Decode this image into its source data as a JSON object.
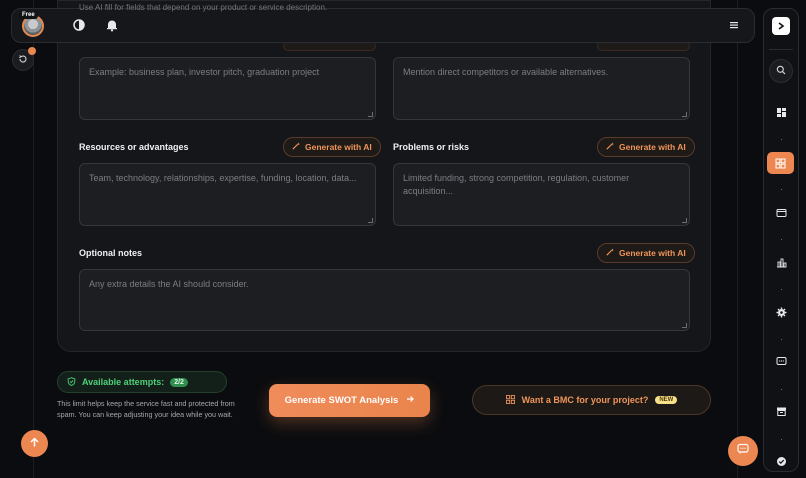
{
  "topbar": {
    "hint": "Use AI fill for fields that depend on your product or service description.",
    "plan_badge": "Free",
    "icons": [
      "theme-toggle-icon",
      "bell-icon",
      "menu-icon"
    ]
  },
  "form": {
    "context_placeholder": "Example: business plan, investor pitch, graduation project",
    "competitors_placeholder": "Mention direct competitors or available alternatives.",
    "resources_label": "Resources or advantages",
    "resources_placeholder": "Team, technology, relationships, expertise, funding, location, data...",
    "problems_label": "Problems or risks",
    "problems_placeholder": "Limited funding, strong competition, regulation, customer acquisition...",
    "notes_label": "Optional notes",
    "notes_placeholder": "Any extra details the AI should consider.",
    "generate_ai_label": "Generate with AI"
  },
  "footer": {
    "attempts_label": "Available attempts:",
    "attempts_count": "2/2",
    "limit_note": "This limit helps keep the service fast and protected from spam. You can keep adjusting your idea while you wait.",
    "primary_label": "Generate SWOT Analysis",
    "bmc_label": "Want a BMC for your project?",
    "bmc_badge": "NEW"
  },
  "rail": {
    "items": [
      "dashboard-icon",
      "apps-icon",
      "wallet-icon",
      "chart-icon",
      "settings-icon",
      "chat-icon",
      "archive-icon",
      "check-icon"
    ],
    "active_index": 1
  },
  "colors": {
    "accent": "#ec8751",
    "background": "#0b0c0f",
    "success": "#4fcf7a"
  }
}
